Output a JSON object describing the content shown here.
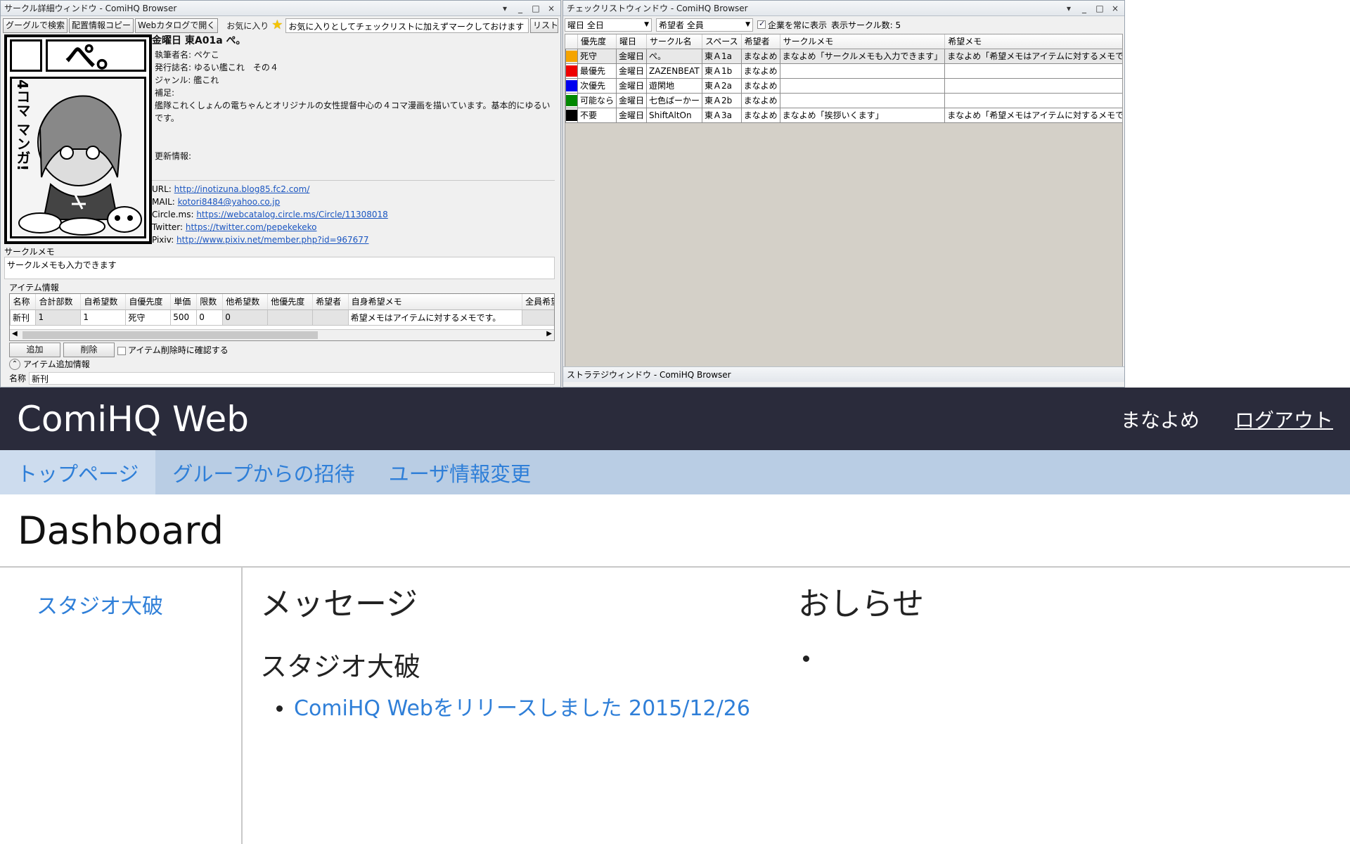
{
  "left_window": {
    "title": "サークル詳細ウィンドウ - ComiHQ Browser",
    "controls": [
      "▾",
      "_",
      "□",
      "×"
    ],
    "toolbar": {
      "google_search": "グーグルで検索",
      "copy_placement": "配置情報コピー",
      "open_web_catalog": "Webカタログで開く",
      "favorite_label": "お気に入り",
      "favorite_memo": "お気に入りとしてチェックリストに加えずマークしておけます",
      "list_button": "リスト"
    },
    "cover": {
      "title_text": "ぺ。",
      "vertical_text": "4コマ マンガ!"
    },
    "circle": {
      "heading": "金曜日 東A01a ぺ。",
      "author": "執筆者名: ペケこ",
      "publication": "発行誌名: ゆるい艦これ　その４",
      "genre": "ジャンル: 艦これ",
      "supplement_label": "補足:",
      "description": "艦隊これくしょんの電ちゃんとオリジナルの女性提督中心の４コマ漫画を描いています。基本的にゆるいです。",
      "update_label": "更新情報:"
    },
    "links": {
      "url_label": "URL: ",
      "url": "http://inotizuna.blog85.fc2.com/",
      "mail_label": "MAIL: ",
      "mail": "kotori8484@yahoo.co.jp",
      "circlems_label": "Circle.ms: ",
      "circlems": "https://webcatalog.circle.ms/Circle/11308018",
      "twitter_label": "Twitter: ",
      "twitter": "https://twitter.com/pepekekeko",
      "pixiv_label": "Pixiv: ",
      "pixiv": "http://www.pixiv.net/member.php?id=967677"
    },
    "memo_label": "サークルメモ",
    "memo_text": "サークルメモも入力できます",
    "items_label": "アイテム情報",
    "items_headers": [
      "名称",
      "合計部数",
      "自希望数",
      "自優先度",
      "単価",
      "限数",
      "他希望数",
      "他優先度",
      "希望者",
      "自身希望メモ",
      "全員希望メモ"
    ],
    "items_rows": [
      [
        "新刊",
        "1",
        "1",
        "死守",
        "500",
        "0",
        "0",
        "",
        "",
        "希望メモはアイテムに対するメモです。",
        ""
      ]
    ],
    "add_button": "追加",
    "delete_button": "削除",
    "confirm_delete_label": "アイテム削除時に確認する",
    "add_info_label": "アイテム追加情報",
    "name_label": "名称",
    "name_value": "新刊"
  },
  "right_window": {
    "title": "チェックリストウィンドウ - ComiHQ Browser",
    "controls": [
      "▾",
      "_",
      "□",
      "×"
    ],
    "day_filter": "曜日 全日",
    "wisher_filter": "希望者 全員",
    "always_show_companies": "企業を常に表示",
    "circle_count": "表示サークル数: 5",
    "headers": [
      "",
      "優先度",
      "曜日",
      "サークル名",
      "スペース",
      "希望者",
      "サークルメモ",
      "希望メモ"
    ],
    "rows": [
      {
        "color": "#f5a400",
        "priority": "死守",
        "day": "金曜日",
        "circle": "ぺ。",
        "space": "東Ａ1a",
        "wisher": "まなよめ",
        "circle_memo": "まなよめ「サークルメモも入力できます」",
        "wish_memo": "まなよめ「希望メモはアイテムに対するメモです」"
      },
      {
        "color": "#ee0000",
        "priority": "最優先",
        "day": "金曜日",
        "circle": "ZAZENBEAT",
        "space": "東Ａ1b",
        "wisher": "まなよめ",
        "circle_memo": "",
        "wish_memo": ""
      },
      {
        "color": "#0000ee",
        "priority": "次優先",
        "day": "金曜日",
        "circle": "遊閑地",
        "space": "東Ａ2a",
        "wisher": "まなよめ",
        "circle_memo": "",
        "wish_memo": ""
      },
      {
        "color": "#008800",
        "priority": "可能なら",
        "day": "金曜日",
        "circle": "七色ぱーかー",
        "space": "東Ａ2b",
        "wisher": "まなよめ",
        "circle_memo": "",
        "wish_memo": ""
      },
      {
        "color": "#000000",
        "priority": "不要",
        "day": "金曜日",
        "circle": "ShiftAltOn",
        "space": "東Ａ3a",
        "wisher": "まなよめ",
        "circle_memo": "まなよめ「挨拶いくます」",
        "wish_memo": "まなよめ「希望メモはアイテムに対するメモです」"
      }
    ],
    "strategy_title": "ストラテジウィンドウ - ComiHQ Browser"
  },
  "web": {
    "brand": "ComiHQ Web",
    "user": "まなよめ",
    "logout": "ログアウト",
    "tabs": [
      "トップページ",
      "グループからの招待",
      "ユーザ情報変更"
    ],
    "page_title": "Dashboard",
    "sidebar_groups": [
      "スタジオ大破"
    ],
    "messages_heading": "メッセージ",
    "messages_group": "スタジオ大破",
    "messages": [
      "ComiHQ Webをリリースしました 2015/12/26"
    ],
    "news_heading": "おしらせ",
    "news": [
      ""
    ]
  }
}
